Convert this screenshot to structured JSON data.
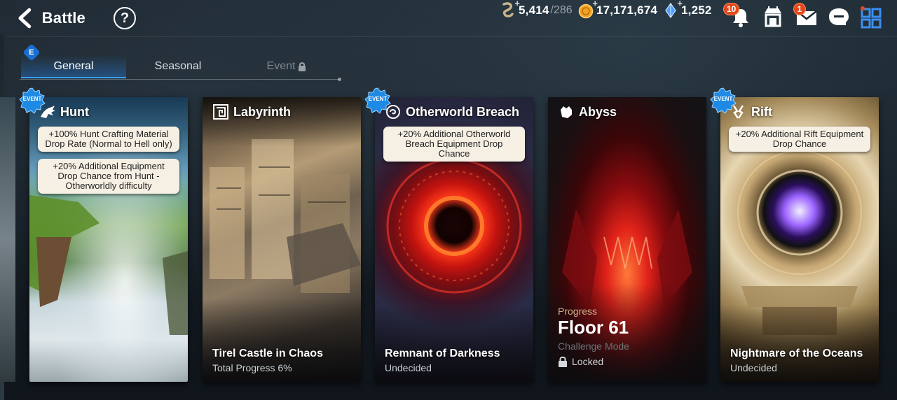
{
  "header": {
    "back_label": "Battle",
    "help_symbol": "?",
    "currencies": [
      {
        "icon": "stamina-icon",
        "value": "5,414",
        "suffix": "/286",
        "color": "#c9b48a"
      },
      {
        "icon": "gold-icon",
        "value": "17,171,674",
        "color": "#f2a321"
      },
      {
        "icon": "crystal-icon",
        "value": "1,252",
        "color": "#6fb5ff"
      }
    ],
    "notifications": {
      "bell_count": "10",
      "mail_count": "1"
    },
    "plus_symbol": "+"
  },
  "tabs": {
    "event_badge": "E",
    "items": [
      {
        "label": "General",
        "state": "active"
      },
      {
        "label": "Seasonal",
        "state": "inactive"
      },
      {
        "label": "Event",
        "state": "locked"
      }
    ]
  },
  "event_seal_label": "EVENT",
  "cards": [
    {
      "name": "Hunt",
      "event": true,
      "bonuses": [
        "+100% Hunt Crafting Material Drop Rate (Normal to Hell only)",
        "+20% Additional Equipment Drop Chance from Hunt - Otherworldly difficulty"
      ]
    },
    {
      "name": "Labyrinth",
      "event": false,
      "place": "Tirel Castle in Chaos",
      "status": "Total Progress 6%"
    },
    {
      "name": "Otherworld Breach",
      "event": true,
      "bonuses": [
        "+20% Additional Otherworld Breach Equipment Drop Chance"
      ],
      "place": "Remnant of Darkness",
      "status": "Undecided"
    },
    {
      "name": "Abyss",
      "event": false,
      "progress_label": "Progress",
      "floor": "Floor 61",
      "mode": "Challenge Mode",
      "mode_status": "Locked"
    },
    {
      "name": "Rift",
      "event": true,
      "bonuses": [
        "+20% Additional Rift Equipment Drop Chance"
      ],
      "place": "Nightmare of the Oceans",
      "status": "Undecided"
    }
  ]
}
